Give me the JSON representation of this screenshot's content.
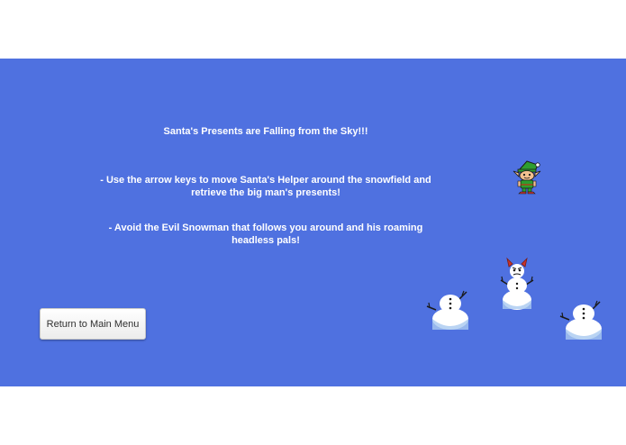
{
  "colors": {
    "sky": "#4f71e0",
    "text": "#ffffff",
    "snow": "#ffffff",
    "snow_shadow": "#a9c9f0",
    "elf_green": "#2e9e2e",
    "horns": "#c8332a"
  },
  "instructions": {
    "title": "Santa's Presents are Falling from the Sky!!!",
    "move": "- Use the arrow keys to move Santa's Helper around the snowfield and retrieve the big man's presents!",
    "avoid": "- Avoid the Evil Snowman that follows you around and his roaming headless pals!"
  },
  "buttons": {
    "return_menu": "Return to Main Menu"
  },
  "sprites": {
    "player": "elf-sprite",
    "boss": "evil-snowman-sprite",
    "enemies": [
      "headless-snowman-sprite",
      "headless-snowman-sprite"
    ]
  }
}
